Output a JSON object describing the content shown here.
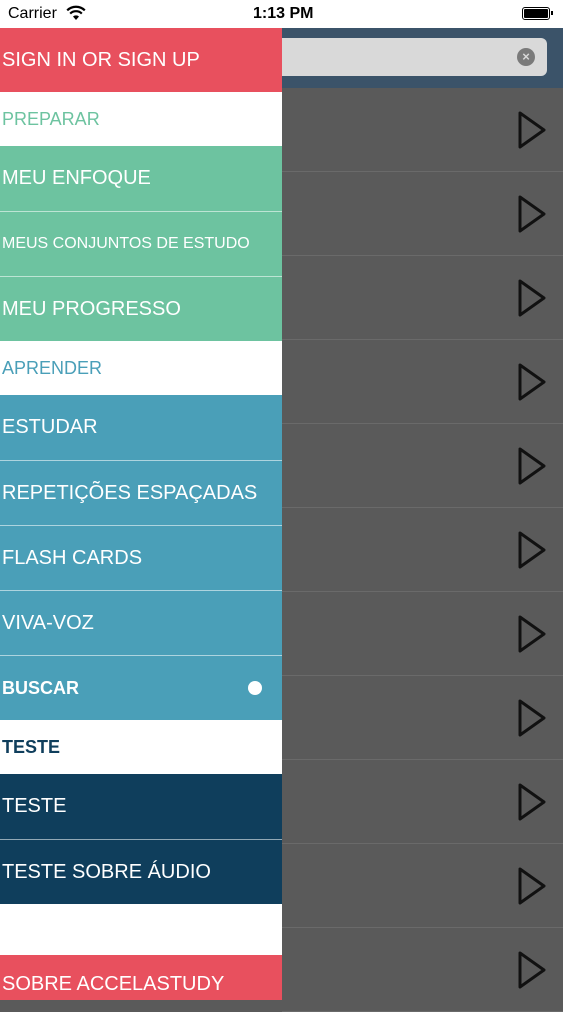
{
  "status": {
    "carrier": "Carrier",
    "time": "1:13 PM"
  },
  "drawer": {
    "sign_in": "SIGN IN OR SIGN UP",
    "preparar_header": "PREPARAR",
    "preparar_items": [
      "MEU ENFOQUE",
      "MEUS CONJUNTOS DE ESTUDO",
      "MEU PROGRESSO"
    ],
    "aprender_header": "APRENDER",
    "aprender_items": [
      "ESTUDAR",
      "REPETIÇÕES ESPAÇADAS",
      "FLASH CARDS",
      "VIVA-VOZ",
      "BUSCAR"
    ],
    "teste_header": "TESTE",
    "teste_items": [
      "TESTE",
      "TESTE SOBRE ÁUDIO"
    ],
    "about": "SOBRE ACCELASTUDY"
  },
  "colors": {
    "red": "#e8505e",
    "green": "#6dc3a0",
    "teal": "#4a9fb8",
    "navy": "#0f3e5c",
    "overlay": "#5a5a5a"
  },
  "icons": {
    "wifi": "wifi-icon",
    "battery": "battery-icon",
    "clear": "clear-icon",
    "play": "play-icon",
    "toggle": "dot-icon"
  }
}
